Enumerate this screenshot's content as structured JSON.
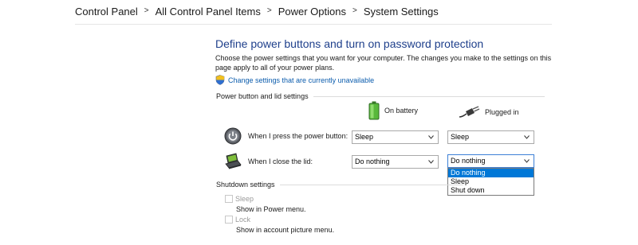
{
  "breadcrumb": {
    "items": [
      "Control Panel",
      "All Control Panel Items",
      "Power Options",
      "System Settings"
    ]
  },
  "page": {
    "heading": "Define power buttons and turn on password protection",
    "description": "Choose the power settings that you want for your computer. The changes you make to the settings on this page apply to all of your power plans.",
    "change_link": "Change settings that are currently unavailable"
  },
  "power_section": {
    "title": "Power button and lid settings",
    "columns": {
      "battery": "On battery",
      "plugged": "Plugged in"
    },
    "rows": [
      {
        "label": "When I press the power button:",
        "battery": "Sleep",
        "plugged": "Sleep"
      },
      {
        "label": "When I close the lid:",
        "battery": "Do nothing",
        "plugged": "Do nothing"
      }
    ],
    "dropdown": {
      "options": [
        "Do nothing",
        "Sleep",
        "Shut down"
      ],
      "selected": "Do nothing"
    }
  },
  "shutdown_section": {
    "title": "Shutdown settings",
    "items": [
      {
        "label": "Sleep",
        "sub": "Show in Power menu.",
        "checked": false
      },
      {
        "label": "Lock",
        "sub": "Show in account picture menu.",
        "checked": false
      }
    ]
  },
  "colors": {
    "heading": "#1e3f8b",
    "link": "#0b5cad",
    "selection": "#0078d7"
  },
  "icons": [
    "chevron-right-icon",
    "uac-shield-icon",
    "battery-icon",
    "power-plug-icon",
    "power-button-icon",
    "laptop-lid-icon",
    "chevron-down-icon"
  ]
}
